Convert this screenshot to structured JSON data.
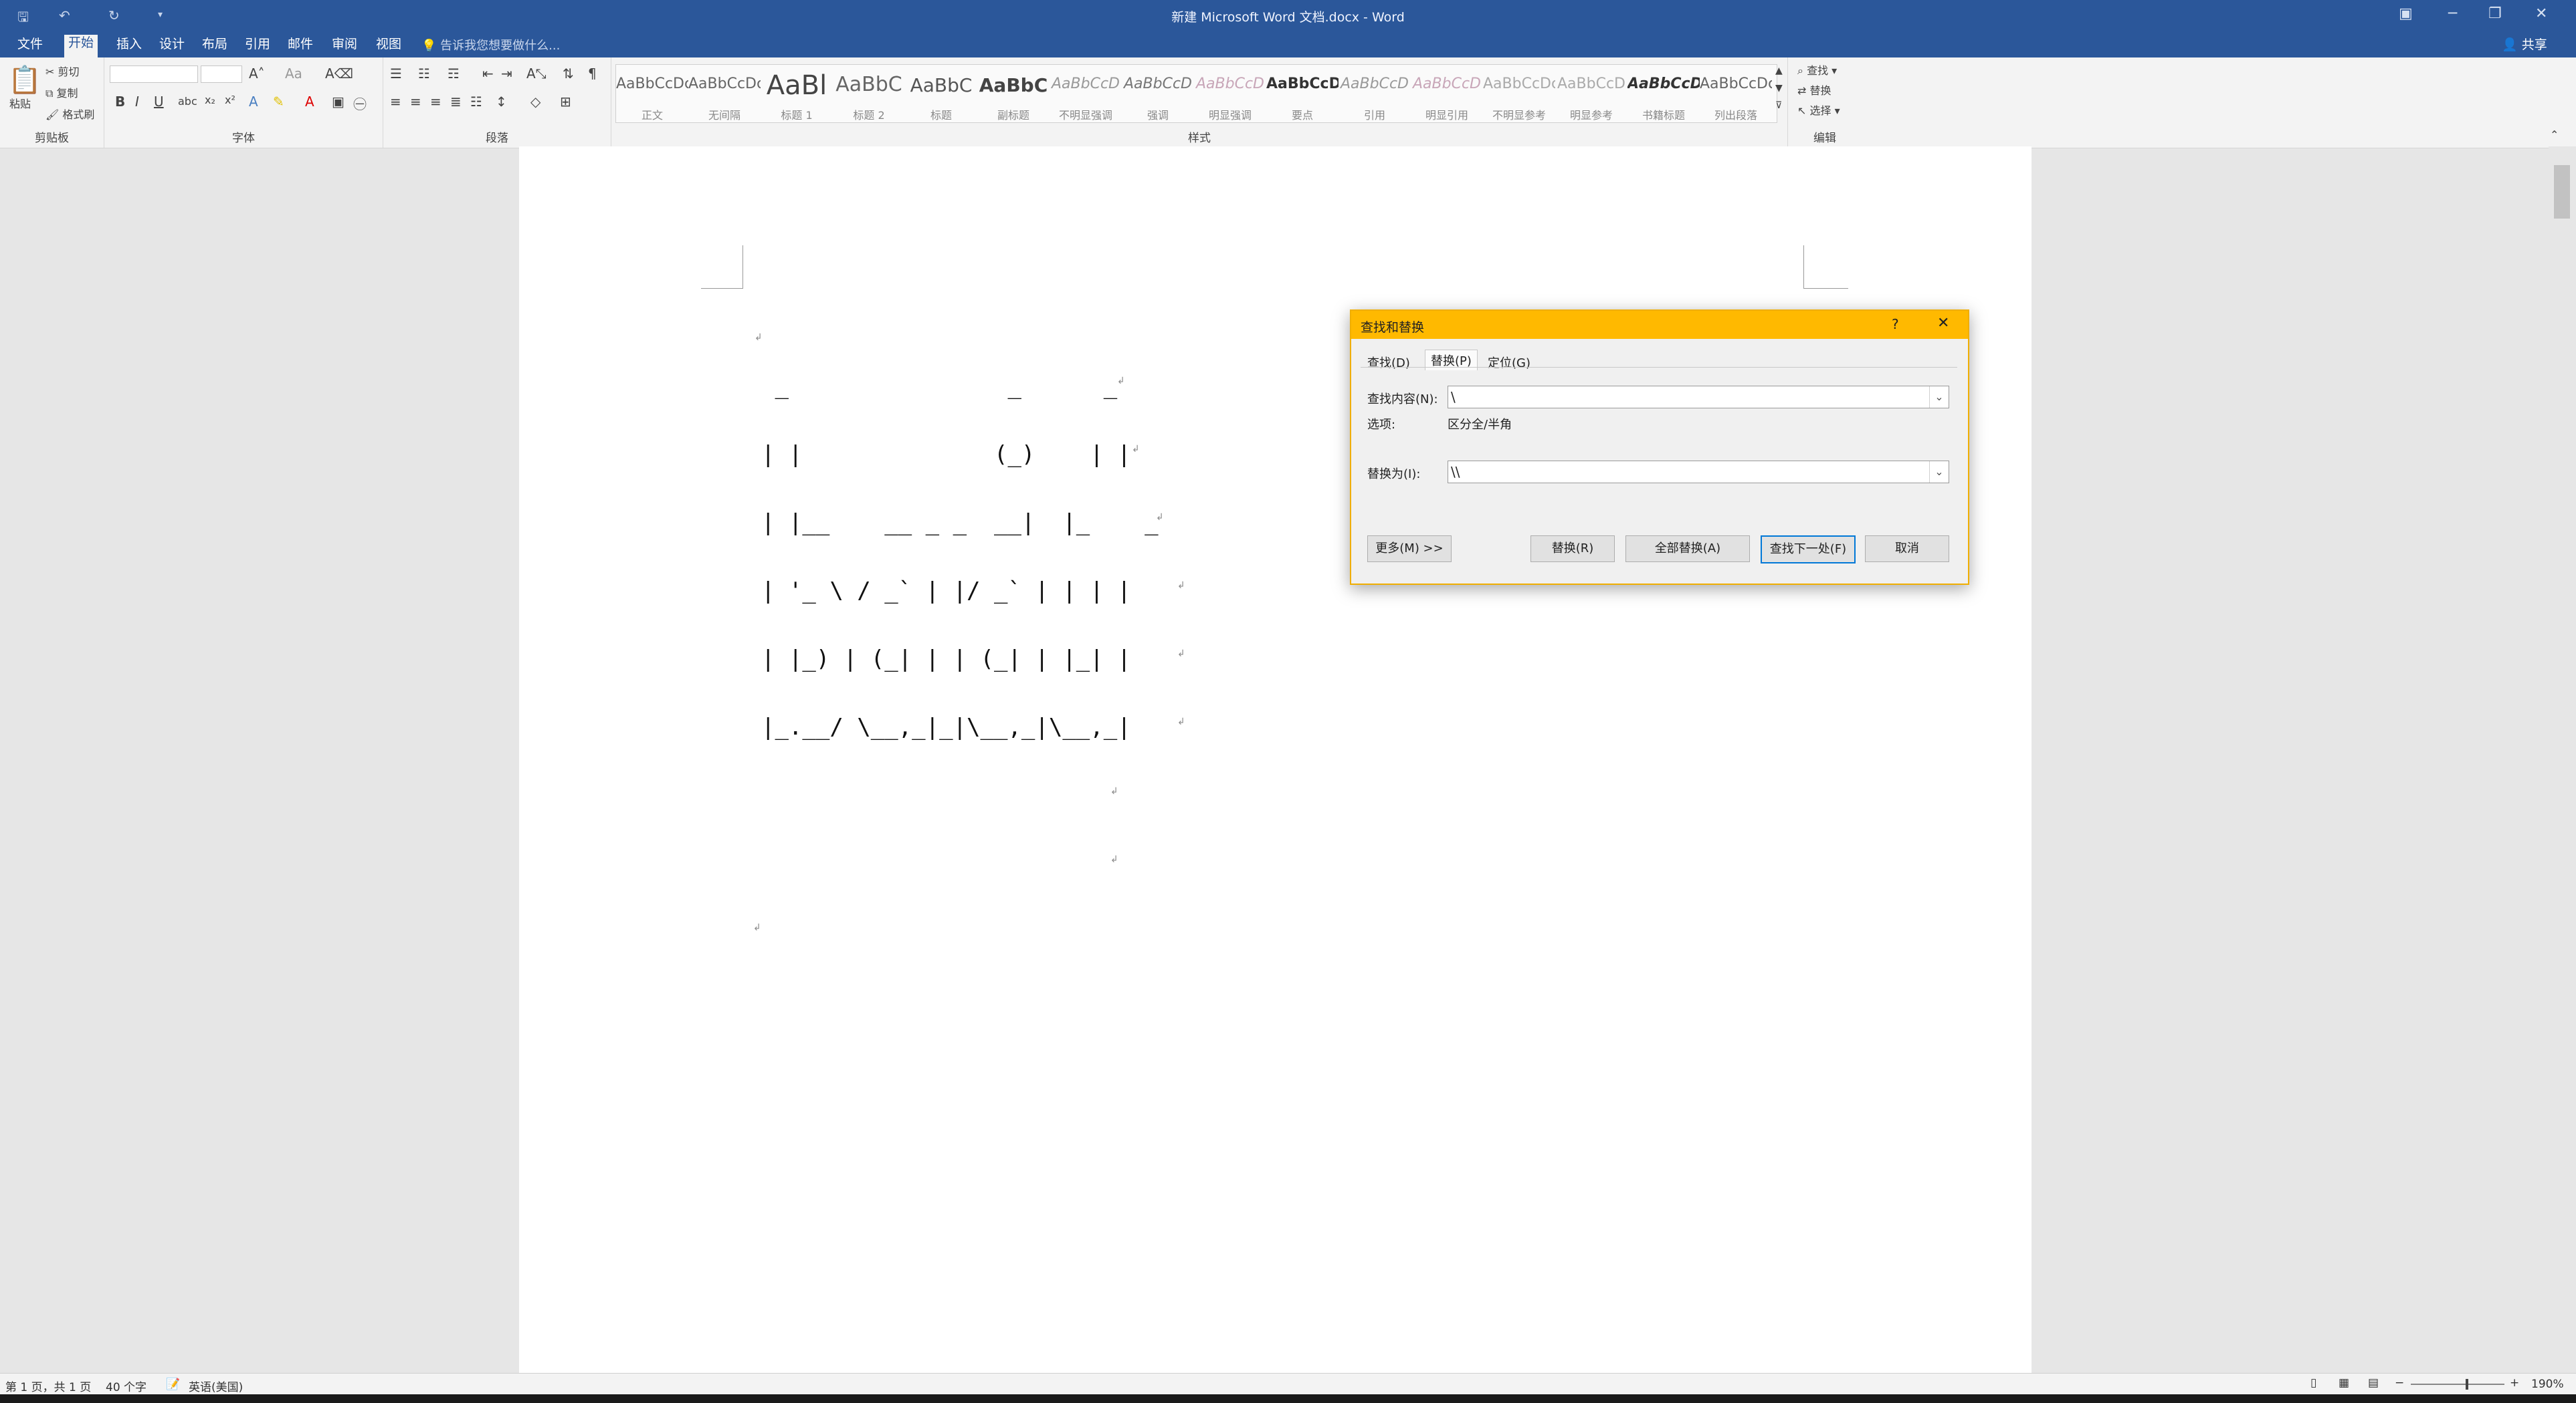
{
  "window": {
    "title": "新建 Microsoft Word 文档.docx - Word",
    "quick_access": [
      "save-icon",
      "undo-icon",
      "redo-icon",
      "customize-icon"
    ],
    "controls": [
      "ribbon-display-icon",
      "minimize-icon",
      "restore-icon",
      "close-icon"
    ]
  },
  "menu": {
    "tabs": [
      "文件",
      "开始",
      "插入",
      "设计",
      "布局",
      "引用",
      "邮件",
      "审阅",
      "视图"
    ],
    "active": "开始",
    "tell_me": "告诉我您想要做什么...",
    "share": "共享"
  },
  "ribbon": {
    "clipboard": {
      "paste": "粘贴",
      "cut": "剪切",
      "copy": "复制",
      "format_painter": "格式刷",
      "label": "剪贴板"
    },
    "font": {
      "label": "字体",
      "bold": "B",
      "italic": "I",
      "underline": "U"
    },
    "paragraph": {
      "label": "段落"
    },
    "styles": {
      "label": "样式",
      "items": [
        {
          "sample": "AaBbCcDc",
          "name": "正文"
        },
        {
          "sample": "AaBbCcDc",
          "name": "无间隔"
        },
        {
          "sample": "AaBl",
          "name": "标题 1"
        },
        {
          "sample": "AaBbC",
          "name": "标题 2"
        },
        {
          "sample": "AaBbC",
          "name": "标题"
        },
        {
          "sample": "AaBbC",
          "name": "副标题"
        },
        {
          "sample": "AaBbCcD",
          "name": "不明显强调"
        },
        {
          "sample": "AaBbCcD",
          "name": "强调"
        },
        {
          "sample": "AaBbCcD",
          "name": "明显强调"
        },
        {
          "sample": "AaBbCcD",
          "name": "要点"
        },
        {
          "sample": "AaBbCcD",
          "name": "引用"
        },
        {
          "sample": "AaBbCcD",
          "name": "明显引用"
        },
        {
          "sample": "AaBbCcDc",
          "name": "不明显参考"
        },
        {
          "sample": "AaBbCcD",
          "name": "明显参考"
        },
        {
          "sample": "AaBbCcD",
          "name": "书籍标题"
        },
        {
          "sample": "AaBbCcDc",
          "name": "列出段落"
        }
      ]
    },
    "editing": {
      "find": "查找",
      "replace": "替换",
      "select": "选择",
      "label": "编辑"
    }
  },
  "document": {
    "art_lines": [
      " _                _      _",
      "| |              (_)    | |",
      "| |__    __ _ _  __|  |_    _",
      "| '_ \\ / _` | |/ _` | | | |",
      "| |_) | (_| | | (_| | |_| |",
      "|_.__/ \\__,_|_|\\__,_|\\__,_|"
    ]
  },
  "dialog": {
    "title": "查找和替换",
    "help": "?",
    "tabs": [
      "查找(D)",
      "替换(P)",
      "定位(G)"
    ],
    "active_tab": "替换(P)",
    "find_label": "查找内容(N):",
    "find_value": "\\",
    "options_label": "选项:",
    "options_value": "区分全/半角",
    "replace_label": "替换为(I):",
    "replace_value": "\\\\",
    "buttons": {
      "more": "更多(M) >>",
      "replace": "替换(R)",
      "replace_all": "全部替换(A)",
      "find_next": "查找下一处(F)",
      "cancel": "取消"
    }
  },
  "status": {
    "page": "第 1 页，共 1 页",
    "words": "40 个字",
    "language": "英语(美国)",
    "zoom": "190%"
  },
  "colors": {
    "brand": "#2b579a",
    "dialog_title": "#ffb900",
    "default_button_border": "#0078d7"
  }
}
